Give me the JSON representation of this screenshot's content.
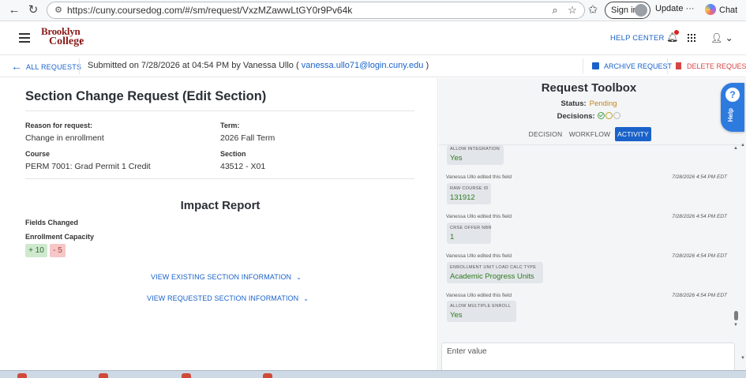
{
  "browser": {
    "url": "https://cuny.coursedog.com/#/sm/request/VxzMZawwLtGY0r9Pv64k",
    "signin_label": "Sign in",
    "update_label": "Update",
    "chat_label": "Chat"
  },
  "header": {
    "logo_line1": "Brooklyn",
    "logo_line2": "College",
    "help_center": "HELP CENTER"
  },
  "request_bar": {
    "back_label": "ALL REQUESTS",
    "submitted_prefix": "Submitted on 7/28/2026 at 04:54 PM by Vanessa Ullo (",
    "submitter_email": "vanessa.ullo71@login.cuny.edu",
    "submitted_suffix": ")",
    "archive_label": "ARCHIVE REQUEST",
    "delete_label": "DELETE REQUEST"
  },
  "request": {
    "title": "Section Change Request (Edit Section)",
    "reason_label": "Reason for request:",
    "reason_value": "Change in enrollment",
    "term_label": "Term:",
    "term_value": "2026 Fall Term",
    "course_label": "Course",
    "course_value": "PERM 7001: Grad Permit 1 Credit",
    "section_label": "Section",
    "section_value": "43512 - X01"
  },
  "impact": {
    "title": "Impact Report",
    "fields_changed_label": "Fields Changed",
    "field_name": "Enrollment Capacity",
    "added": "+ 10",
    "removed": "- 5",
    "view_existing": "VIEW EXISTING SECTION INFORMATION",
    "view_requested": "VIEW REQUESTED SECTION INFORMATION"
  },
  "toolbox": {
    "title": "Request Toolbox",
    "status_label": "Status:",
    "status_value": "Pending",
    "decisions_label": "Decisions:",
    "tabs": [
      "DECISION",
      "WORKFLOW",
      "ACTIVITY"
    ],
    "active_tab": "ACTIVITY",
    "comment_placeholder": "Enter value",
    "help_label": "Help"
  },
  "activity": [
    {
      "author": "",
      "time": "",
      "field": "ALLOW INTEGRATION",
      "value": "Yes"
    },
    {
      "author": "Vanessa Ullo edited this field",
      "time": "7/28/2026 4:54 PM EDT",
      "field": "RAW COURSE ID",
      "value": "131912"
    },
    {
      "author": "Vanessa Ullo edited this field",
      "time": "7/28/2026 4:54 PM EDT",
      "field": "CRSE OFFER NBR",
      "value": "1"
    },
    {
      "author": "Vanessa Ullo edited this field",
      "time": "7/28/2026 4:54 PM EDT",
      "field": "ENROLLMENT UNIT LOAD CALC TYPE",
      "value": "Academic Progress Units"
    },
    {
      "author": "Vanessa Ullo edited this field",
      "time": "7/28/2026 4:54 PM EDT",
      "field": "ALLOW MULTIPLE ENROLL",
      "value": "Yes"
    }
  ],
  "colors": {
    "link": "#1a62c9",
    "pending": "#c2861a",
    "delete": "#d64545",
    "brand": "#8a1a1a",
    "value_green": "#2f7a1e"
  }
}
